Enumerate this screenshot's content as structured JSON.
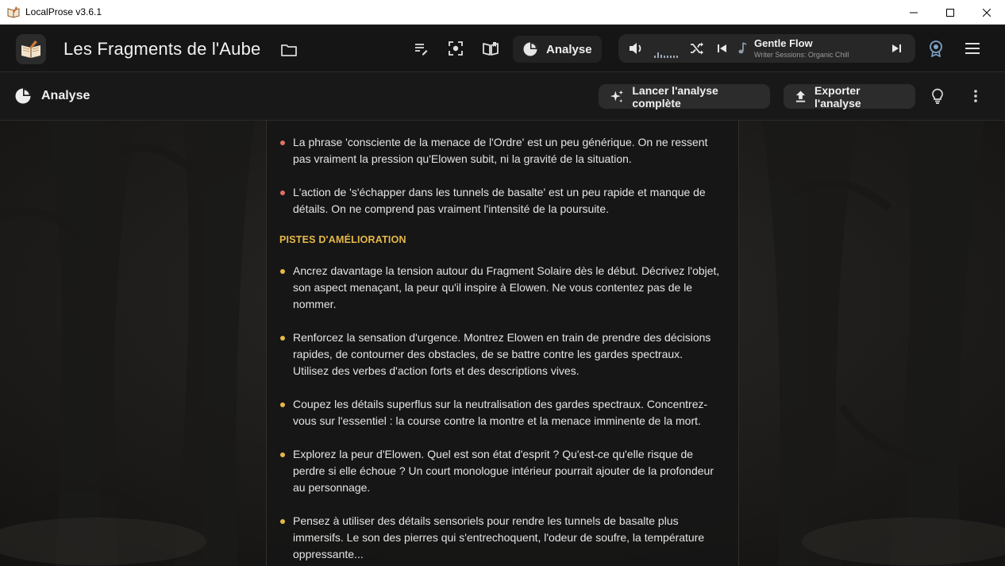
{
  "window": {
    "title": "LocalProse v3.6.1"
  },
  "header": {
    "project_title": "Les Fragments de l'Aube",
    "analyse_tab_label": "Analyse",
    "player": {
      "track_name": "Gentle Flow",
      "track_artist": "Writer Sessions: Organic Chill"
    }
  },
  "toolbar": {
    "section_title": "Analyse",
    "run_label": "Lancer l'analyse complète",
    "export_label": "Exporter l'analyse"
  },
  "content": {
    "weaknesses": [
      "La phrase 'consciente de la menace de l'Ordre' est un peu générique. On ne ressent pas vraiment la pression qu'Elowen subit, ni la gravité de la situation.",
      "L'action de 's'échapper dans les tunnels de basalte' est un peu rapide et manque de détails. On ne comprend pas vraiment l'intensité de la poursuite."
    ],
    "improvements_heading": "PISTES D'AMÉLIORATION",
    "improvements": [
      "Ancrez davantage la tension autour du Fragment Solaire dès le début. Décrivez l'objet, son aspect menaçant, la peur qu'il inspire à Elowen.  Ne vous contentez pas de le nommer.",
      "Renforcez la sensation d'urgence. Montrez Elowen en train de prendre des décisions rapides, de contourner des obstacles, de se battre contre les gardes spectraux. Utilisez des verbes d'action forts et des descriptions vives.",
      "Coupez les détails superflus sur la neutralisation des gardes spectraux. Concentrez-vous sur l'essentiel : la course contre la montre et la menace imminente de la mort.",
      "Explorez la peur d'Elowen.  Quel est son état d'esprit ?  Qu'est-ce qu'elle risque de perdre si elle échoue ?  Un court monologue intérieur pourrait ajouter de la profondeur au personnage.",
      "Pensez à utiliser des détails sensoriels pour rendre les tunnels de basalte plus immersifs.  Le son des pierres qui s'entrechoquent, l'odeur de soufre, la température oppressante..."
    ]
  },
  "colors": {
    "weakness_bullet": "#e0706a",
    "improvement_bullet": "#e6b84a",
    "heading": "#e6b84a"
  }
}
